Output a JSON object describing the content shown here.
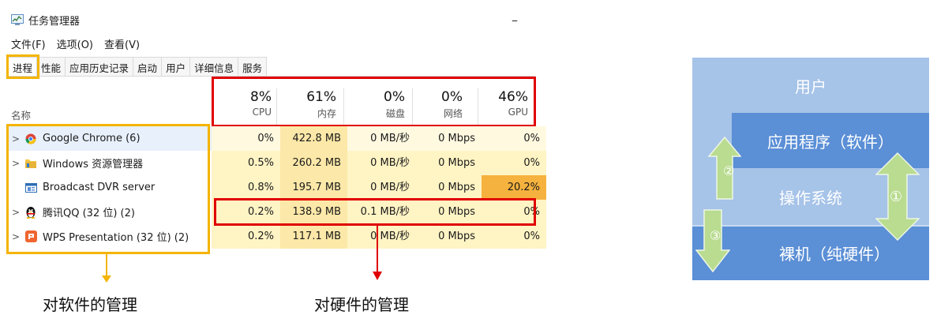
{
  "window": {
    "title": "任务管理器",
    "minimize_glyph": "–"
  },
  "menu": [
    "文件(F)",
    "选项(O)",
    "查看(V)"
  ],
  "tabs": [
    "进程",
    "性能",
    "应用历史记录",
    "启动",
    "用户",
    "详细信息",
    "服务"
  ],
  "active_tab": "进程",
  "name_column_header": "名称",
  "metrics": [
    {
      "pct": "8%",
      "label": "CPU"
    },
    {
      "pct": "61%",
      "label": "内存"
    },
    {
      "pct": "0%",
      "label": "磁盘"
    },
    {
      "pct": "0%",
      "label": "网络"
    },
    {
      "pct": "46%",
      "label": "GPU"
    }
  ],
  "sort_indicator": "˅",
  "processes": [
    {
      "name": "Google Chrome (6)",
      "icon": "chrome-icon",
      "expandable": true,
      "cpu": "0%",
      "memory": "422.8 MB",
      "disk": "0 MB/秒",
      "network": "0 Mbps",
      "gpu": "0%"
    },
    {
      "name": "Windows 资源管理器",
      "icon": "folder-icon",
      "expandable": true,
      "cpu": "0.5%",
      "memory": "260.2 MB",
      "disk": "0 MB/秒",
      "network": "0 Mbps",
      "gpu": "0%"
    },
    {
      "name": "Broadcast DVR server",
      "icon": "window-icon",
      "expandable": false,
      "cpu": "0.8%",
      "memory": "195.7 MB",
      "disk": "0 MB/秒",
      "network": "0 Mbps",
      "gpu": "20.2%"
    },
    {
      "name": "腾讯QQ (32 位) (2)",
      "icon": "penguin-icon",
      "expandable": true,
      "cpu": "0.2%",
      "memory": "138.9 MB",
      "disk": "0.1 MB/秒",
      "network": "0 Mbps",
      "gpu": "0%"
    },
    {
      "name": "WPS Presentation (32 位) (2)",
      "icon": "wps-presentation-icon",
      "expandable": true,
      "cpu": "0.2%",
      "memory": "117.1 MB",
      "disk": "0 MB/秒",
      "network": "0 Mbps",
      "gpu": "0%"
    }
  ],
  "captions": {
    "software": "对软件的管理",
    "hardware": "对硬件的管理"
  },
  "diagram": {
    "layers": [
      "用户",
      "应用程序（软件）",
      "操作系统",
      "裸机（纯硬件）"
    ],
    "markers": [
      "①",
      "②",
      "③"
    ]
  },
  "colors": {
    "highlight_yellow": "#f4b400",
    "highlight_red": "#e00000",
    "heat_light": "#fff4c4",
    "heat_mid": "#fce8a8",
    "heat_strong": "#f6b23e",
    "diagram_top": "#a6c3e8",
    "diagram_mid": "#5b8fd6",
    "arrow_green": "#b9dc90"
  }
}
